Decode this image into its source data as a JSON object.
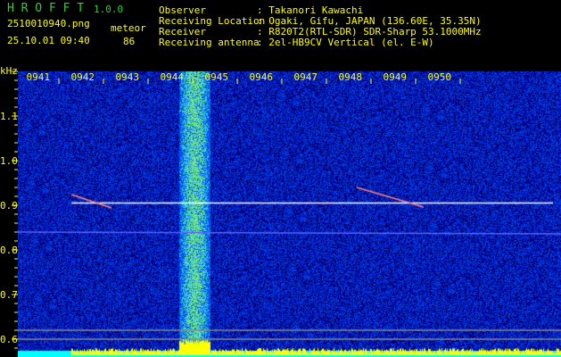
{
  "app": {
    "name": "H R O F F T",
    "version": "1.0.0"
  },
  "file": {
    "name": "2510010940.png",
    "datetime": "25.10.01 09:40"
  },
  "meteor": {
    "label": "meteor",
    "count": "86"
  },
  "info": [
    {
      "key": "Observer",
      "value": ": Takanori Kawachi"
    },
    {
      "key": "Receiving Location",
      "value": ": Ogaki, Gifu, JAPAN (136.60E, 35.35N)"
    },
    {
      "key": "Receiver",
      "value": ": R820T2(RTL-SDR) SDR-Sharp 53.1000MHz"
    },
    {
      "key": "Receiving antenna",
      "value": ": 2el-HB9CV Vertical (el. E-W)"
    }
  ],
  "colors": {
    "text": "#ffff00",
    "title": "#33cc33",
    "background": "#000000",
    "noise": "#1010a0",
    "carrier": "#ffffff",
    "spectrum": "#ffff00",
    "spectrum_base": "#00ffff"
  },
  "chart_data": {
    "type": "heatmap",
    "ylabel": "kHz",
    "x_ticks": [
      "0941",
      "0942",
      "0943",
      "0944",
      "0945",
      "0946",
      "0947",
      "0948",
      "0949",
      "0950"
    ],
    "y_ticks": [
      "1.1",
      "1.0",
      "0.9",
      "0.8",
      "0.7",
      "0.6"
    ],
    "y_tick_values": [
      1.1,
      1.0,
      0.9,
      0.8,
      0.7,
      0.6
    ],
    "ylim": [
      0.57,
      1.2
    ],
    "carrier_khz": 0.905,
    "interference_band_time": "09:43.7",
    "grid": false
  }
}
